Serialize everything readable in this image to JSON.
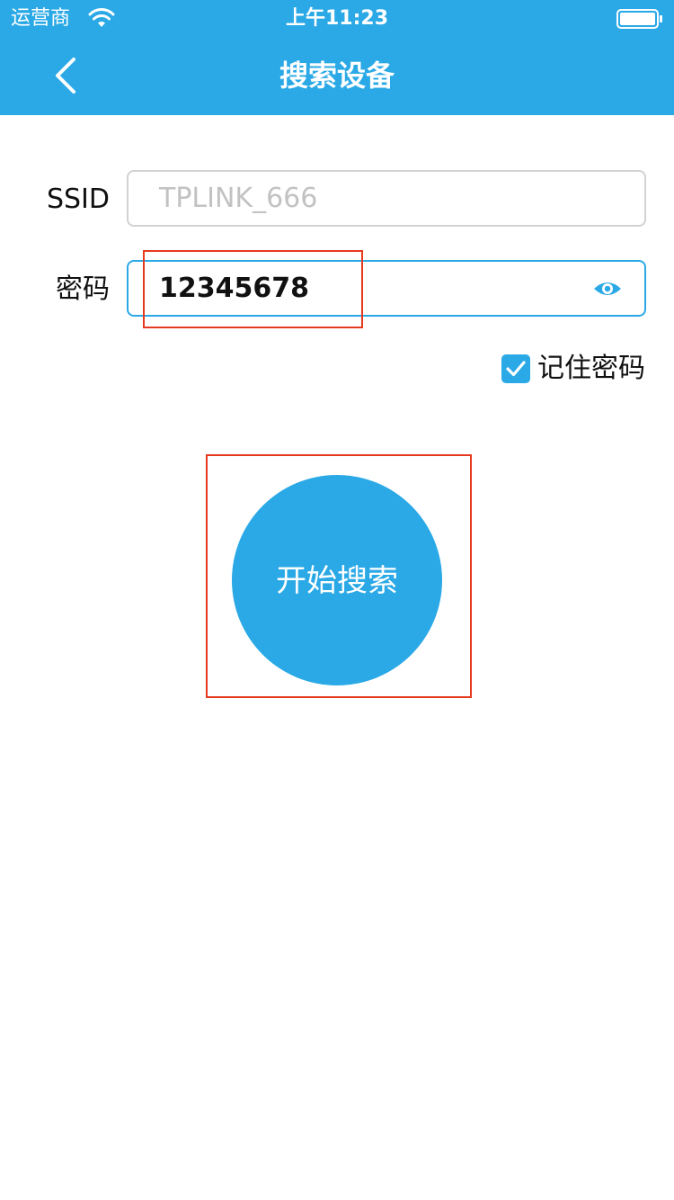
{
  "status_bar": {
    "carrier": "运营商",
    "time": "上午11:23",
    "wifi_icon": "wifi-icon",
    "battery_icon": "battery-icon"
  },
  "nav": {
    "title": "搜索设备",
    "back_icon": "chevron-left-icon"
  },
  "form": {
    "ssid_label": "SSID",
    "ssid_placeholder": "TPLINK_666",
    "password_label": "密码",
    "password_value": "12345678",
    "eye_icon": "eye-icon",
    "remember_label": "记住密码",
    "remember_checked": true
  },
  "action": {
    "start_label": "开始搜索"
  },
  "colors": {
    "accent": "#2aa9e6",
    "highlight": "#e53a1f",
    "input_border": "#d2d2d2",
    "placeholder": "#c2c2c2"
  }
}
